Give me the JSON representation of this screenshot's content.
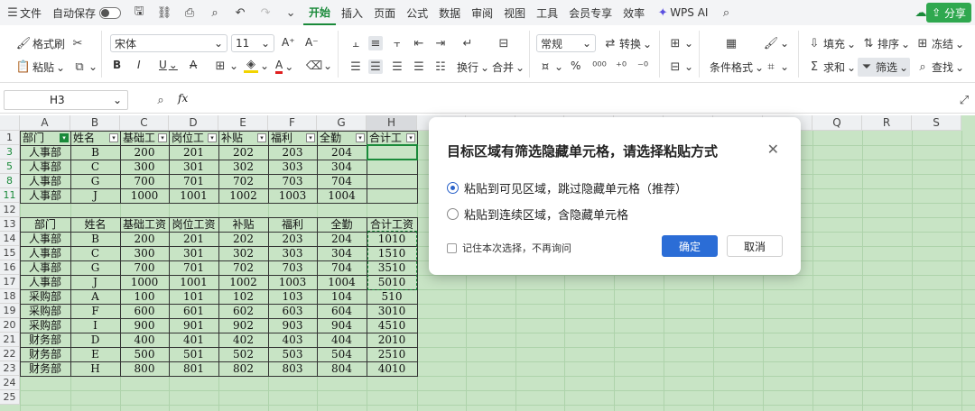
{
  "menubar": {
    "menu_label": "文件",
    "autosave_label": "自动保存",
    "tabs": [
      "开始",
      "插入",
      "页面",
      "公式",
      "数据",
      "审阅",
      "视图",
      "工具",
      "会员专享",
      "效率"
    ],
    "wps_ai": "WPS AI",
    "share": "分享"
  },
  "ribbon": {
    "format_painter": "格式刷",
    "paste": "粘贴",
    "font_name": "宋体",
    "font_size": "11",
    "number_format": "常规",
    "convert": "转换",
    "wrap": "换行",
    "merge": "合并",
    "cond_format": "条件格式",
    "fill": "填充",
    "sort": "排序",
    "freeze": "冻结",
    "sum": "求和",
    "filter": "筛选",
    "find": "查找",
    "bold": "B",
    "italic": "I",
    "underline": "U",
    "strike": "A",
    "fontcolor": "A",
    "fontsize_up": "A⁺",
    "fontsize_down": "A⁻",
    "percent": "%"
  },
  "formula_bar": {
    "cell_ref": "H3",
    "fx": "fx"
  },
  "sheet": {
    "columns": [
      "A",
      "B",
      "C",
      "D",
      "E",
      "F",
      "G",
      "H",
      "",
      "",
      "",
      "Q",
      "R",
      "S"
    ],
    "top_table": {
      "row_numbers": [
        "1",
        "3",
        "5",
        "8",
        "11"
      ],
      "header": [
        "部门",
        "姓名",
        "基础工",
        "岗位工",
        "补贴",
        "福利",
        "全勤",
        "合计工"
      ],
      "rows": [
        [
          "人事部",
          "B",
          "200",
          "201",
          "202",
          "203",
          "204",
          ""
        ],
        [
          "人事部",
          "C",
          "300",
          "301",
          "302",
          "303",
          "304",
          ""
        ],
        [
          "人事部",
          "G",
          "700",
          "701",
          "702",
          "703",
          "704",
          ""
        ],
        [
          "人事部",
          "J",
          "1000",
          "1001",
          "1002",
          "1003",
          "1004",
          ""
        ]
      ]
    },
    "bottom_table": {
      "row_numbers": [
        "12",
        "13",
        "14",
        "15",
        "16",
        "17",
        "18",
        "19",
        "20",
        "21",
        "22",
        "23",
        "24",
        "25"
      ],
      "header": [
        "部门",
        "姓名",
        "基础工资",
        "岗位工资",
        "补贴",
        "福利",
        "全勤",
        "合计工资"
      ],
      "rows": [
        [
          "人事部",
          "B",
          "200",
          "201",
          "202",
          "203",
          "204",
          "1010"
        ],
        [
          "人事部",
          "C",
          "300",
          "301",
          "302",
          "303",
          "304",
          "1510"
        ],
        [
          "人事部",
          "G",
          "700",
          "701",
          "702",
          "703",
          "704",
          "3510"
        ],
        [
          "人事部",
          "J",
          "1000",
          "1001",
          "1002",
          "1003",
          "1004",
          "5010"
        ],
        [
          "采购部",
          "A",
          "100",
          "101",
          "102",
          "103",
          "104",
          "510"
        ],
        [
          "采购部",
          "F",
          "600",
          "601",
          "602",
          "603",
          "604",
          "3010"
        ],
        [
          "采购部",
          "I",
          "900",
          "901",
          "902",
          "903",
          "904",
          "4510"
        ],
        [
          "财务部",
          "D",
          "400",
          "401",
          "402",
          "403",
          "404",
          "2010"
        ],
        [
          "财务部",
          "E",
          "500",
          "501",
          "502",
          "503",
          "504",
          "2510"
        ],
        [
          "财务部",
          "H",
          "800",
          "801",
          "802",
          "803",
          "804",
          "4010"
        ]
      ]
    }
  },
  "dialog": {
    "title": "目标区域有筛选隐藏单元格，请选择粘贴方式",
    "option1": "粘贴到可见区域，跳过隐藏单元格（推荐）",
    "option2": "粘贴到连续区域，含隐藏单元格",
    "remember": "记住本次选择，不再询问",
    "ok": "确定",
    "cancel": "取消"
  }
}
